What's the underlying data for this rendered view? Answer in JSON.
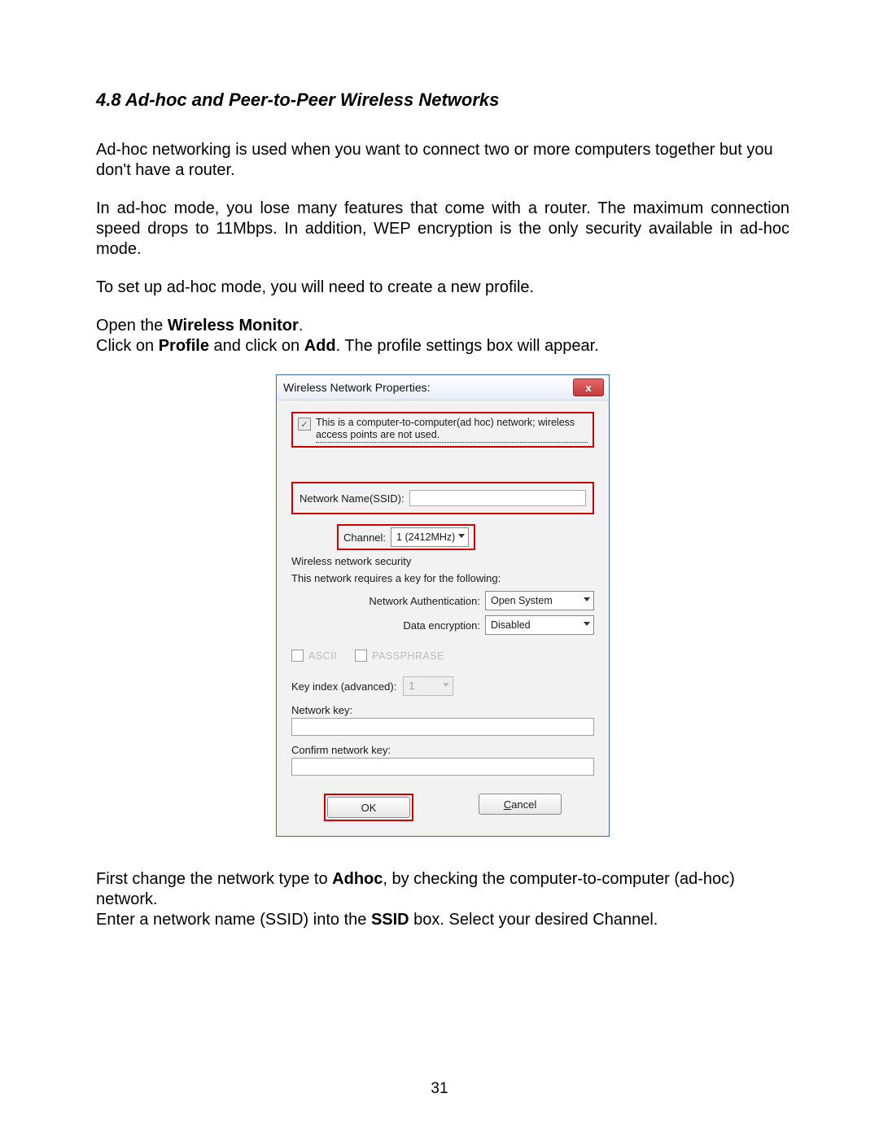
{
  "heading": "4.8 Ad-hoc and Peer-to-Peer Wireless Networks",
  "para1": "Ad-hoc networking is used when you want to connect two or more computers together but you don't have a router.",
  "para2": "In ad-hoc mode, you lose many features that come with a router. The maximum connection speed drops to 11Mbps. In addition, WEP encryption is the only security available in ad-hoc mode.",
  "para3": "To set up ad-hoc mode, you will need to create a new profile.",
  "para4": {
    "prefix": "Open the ",
    "bold": "Wireless Monitor",
    "suffix": "."
  },
  "para5": {
    "a": "Click on ",
    "b": "Profile",
    "c": " and click on ",
    "d": "Add",
    "e": ". The profile settings box will appear."
  },
  "para6": {
    "a": "First change the network type to ",
    "b": "Adhoc",
    "c": ", by checking the computer-to-computer (ad-hoc) network."
  },
  "para7": {
    "a": "Enter a network name (SSID) into the ",
    "b": "SSID",
    "c": " box. Select your desired Channel."
  },
  "page_number": "31",
  "dialog": {
    "title": "Wireless Network Properties:",
    "close_glyph": "x",
    "adhoc_checkbox_label": "This is a computer-to-computer(ad hoc) network; wireless access points are not used.",
    "ssid_label": "Network Name(SSID):",
    "channel_label": "Channel:",
    "channel_value": "1 (2412MHz)",
    "security_header": "Wireless network security",
    "security_note": "This network requires a key for the following:",
    "auth_label": "Network Authentication:",
    "auth_value": "Open System",
    "enc_label": "Data encryption:",
    "enc_value": "Disabled",
    "ascii_label": "ASCII",
    "passphrase_label": "PASSPHRASE",
    "keyindex_label": "Key index (advanced):",
    "keyindex_value": "1",
    "networkkey_label": "Network key:",
    "confirmkey_label": "Confirm network key:",
    "ok_label": "OK",
    "cancel_label": "Cancel",
    "cancel_underline": "C"
  }
}
